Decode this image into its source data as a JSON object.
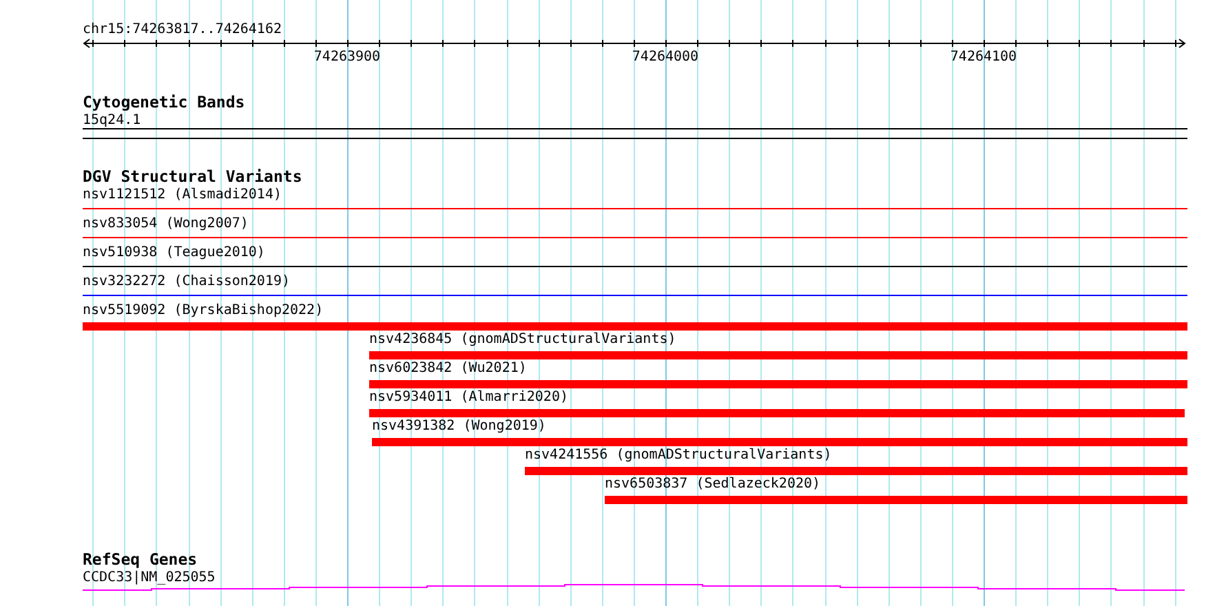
{
  "ruler": {
    "region": "chr15:74263817..74264162",
    "tick_labels": [
      "74263900",
      "74264000",
      "74264100"
    ]
  },
  "tracks": [
    {
      "kind": "bands",
      "title": "Cytogenetic Bands",
      "features": [
        {
          "label": "15q24.1"
        }
      ]
    },
    {
      "kind": "variants",
      "title": "DGV Structural Variants",
      "features": [
        {
          "label": "nsv1121512 (Alsmadi2014)",
          "kind": "line",
          "color": "#ff0000"
        },
        {
          "label": "nsv833054 (Wong2007)",
          "kind": "line",
          "color": "#ff0000"
        },
        {
          "label": "nsv510938 (Teague2010)",
          "kind": "line",
          "color": "#000000"
        },
        {
          "label": "nsv3232272 (Chaisson2019)",
          "kind": "line",
          "color": "#0000ff"
        },
        {
          "label": "nsv5519092 (ByrskaBishop2022)",
          "kind": "bar",
          "color": "#ff0000"
        },
        {
          "label": "nsv4236845 (gnomADStructuralVariants)",
          "kind": "bar",
          "color": "#ff0000"
        },
        {
          "label": "nsv6023842 (Wu2021)",
          "kind": "bar",
          "color": "#ff0000"
        },
        {
          "label": "nsv5934011 (Almarri2020)",
          "kind": "bar",
          "color": "#ff0000"
        },
        {
          "label": "nsv4391382 (Wong2019)",
          "kind": "bar",
          "color": "#ff0000"
        },
        {
          "label": "nsv4241556 (gnomADStructuralVariants)",
          "kind": "bar",
          "color": "#ff0000"
        },
        {
          "label": "nsv6503837 (Sedlazeck2020)",
          "kind": "bar",
          "color": "#ff0000"
        }
      ]
    },
    {
      "kind": "genes",
      "title": "RefSeq Genes",
      "features": [
        {
          "label": "CCDC33|NM_025055"
        }
      ]
    }
  ]
}
